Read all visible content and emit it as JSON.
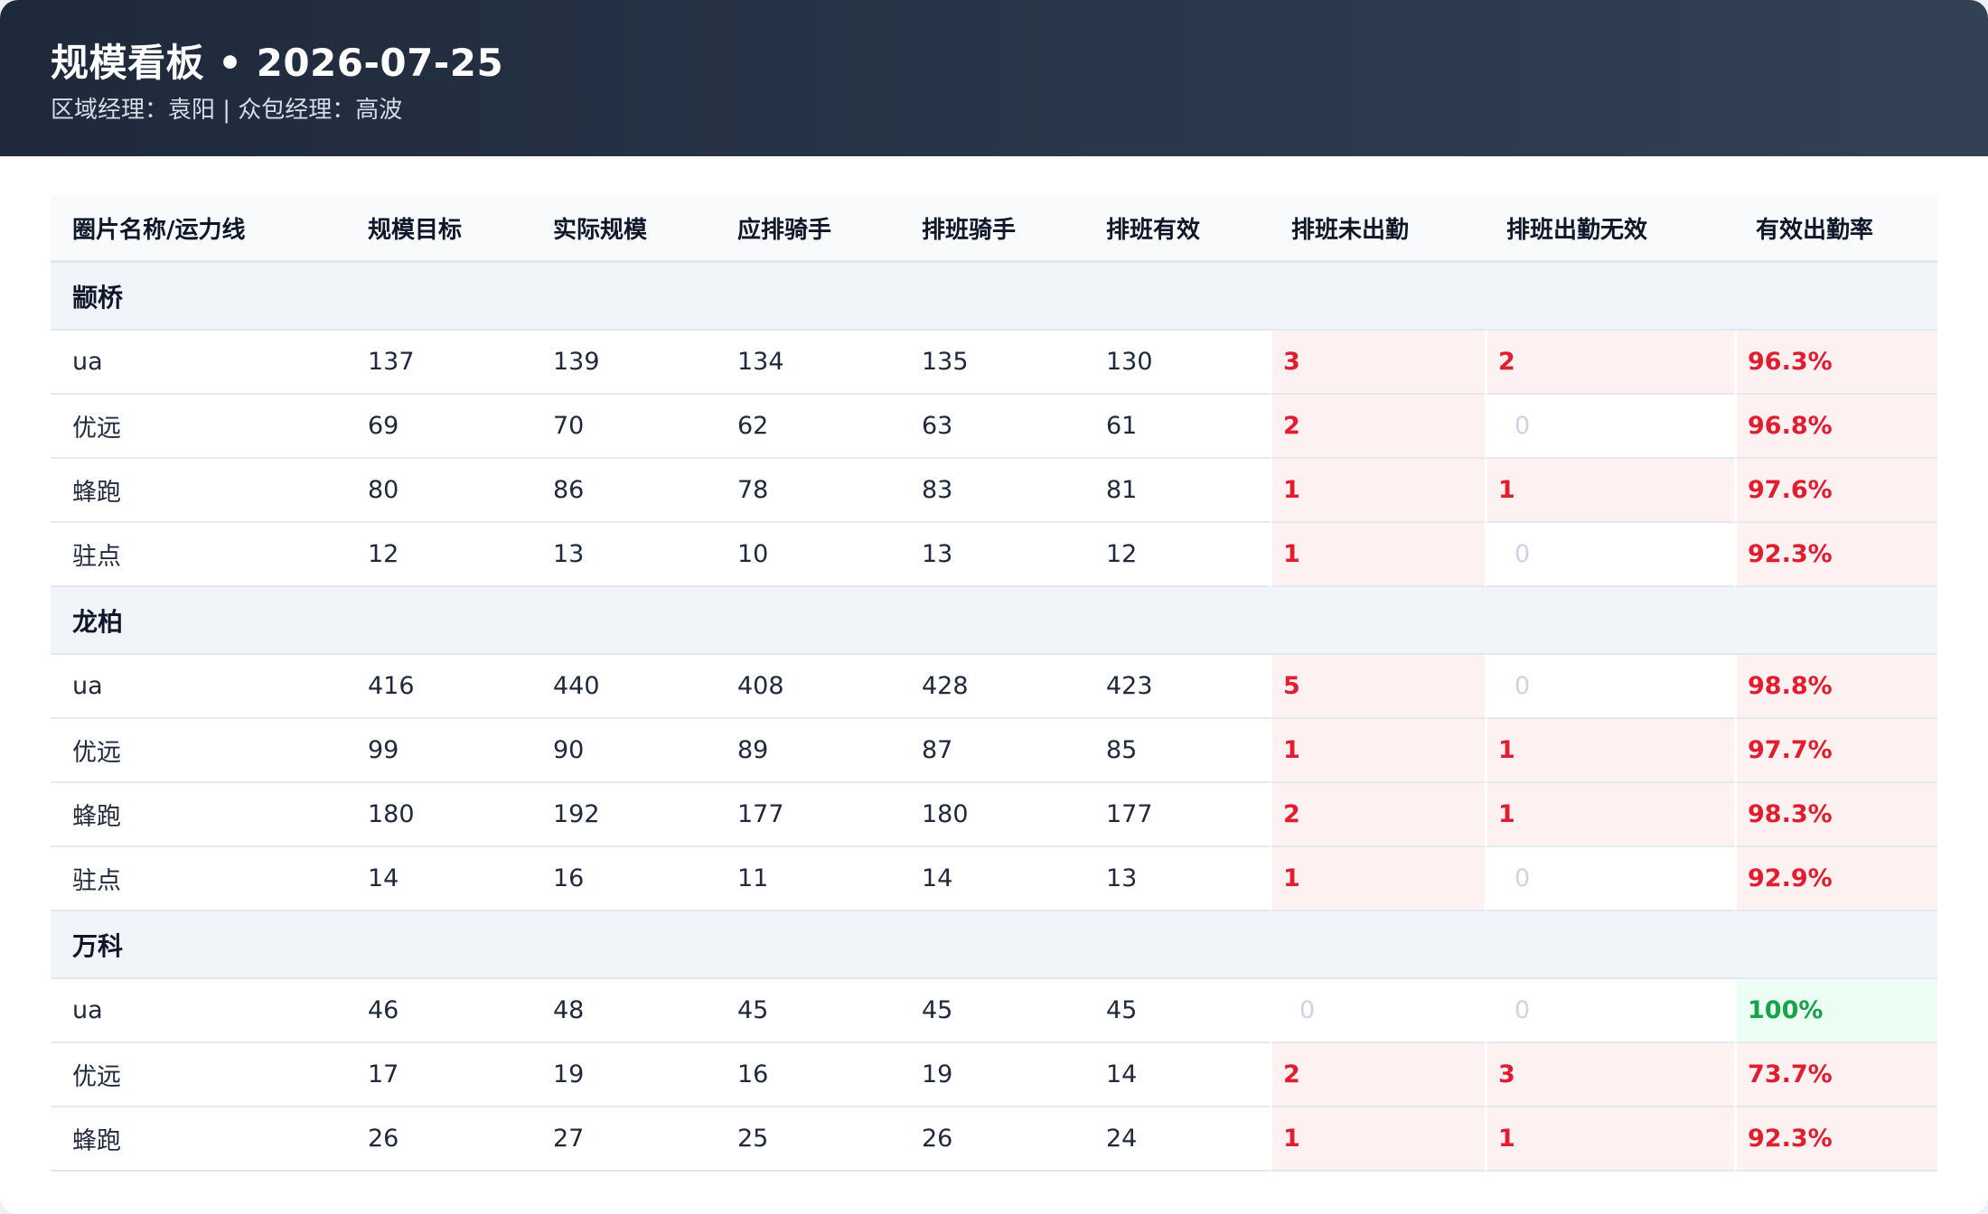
{
  "header": {
    "title": "规模看板 • 2026-07-25",
    "subtitle": "区域经理：袁阳 | 众包经理：高波"
  },
  "table": {
    "columns": [
      "圈片名称/运力线",
      "规模目标",
      "实际规模",
      "应排骑手",
      "排班骑手",
      "排班有效",
      "排班未出勤",
      "排班出勤无效",
      "有效出勤率"
    ],
    "groups": [
      {
        "name": "颛桥",
        "rows": [
          {
            "name": "ua",
            "target": "137",
            "actual": "139",
            "should": "134",
            "scheduled": "135",
            "valid": "130",
            "absent": "3",
            "invalid": "2",
            "rate": "96.3%"
          },
          {
            "name": "优远",
            "target": "69",
            "actual": "70",
            "should": "62",
            "scheduled": "63",
            "valid": "61",
            "absent": "2",
            "invalid": "0",
            "rate": "96.8%"
          },
          {
            "name": "蜂跑",
            "target": "80",
            "actual": "86",
            "should": "78",
            "scheduled": "83",
            "valid": "81",
            "absent": "1",
            "invalid": "1",
            "rate": "97.6%"
          },
          {
            "name": "驻点",
            "target": "12",
            "actual": "13",
            "should": "10",
            "scheduled": "13",
            "valid": "12",
            "absent": "1",
            "invalid": "0",
            "rate": "92.3%"
          }
        ]
      },
      {
        "name": "龙柏",
        "rows": [
          {
            "name": "ua",
            "target": "416",
            "actual": "440",
            "should": "408",
            "scheduled": "428",
            "valid": "423",
            "absent": "5",
            "invalid": "0",
            "rate": "98.8%"
          },
          {
            "name": "优远",
            "target": "99",
            "actual": "90",
            "should": "89",
            "scheduled": "87",
            "valid": "85",
            "absent": "1",
            "invalid": "1",
            "rate": "97.7%"
          },
          {
            "name": "蜂跑",
            "target": "180",
            "actual": "192",
            "should": "177",
            "scheduled": "180",
            "valid": "177",
            "absent": "2",
            "invalid": "1",
            "rate": "98.3%"
          },
          {
            "name": "驻点",
            "target": "14",
            "actual": "16",
            "should": "11",
            "scheduled": "14",
            "valid": "13",
            "absent": "1",
            "invalid": "0",
            "rate": "92.9%"
          }
        ]
      },
      {
        "name": "万科",
        "rows": [
          {
            "name": "ua",
            "target": "46",
            "actual": "48",
            "should": "45",
            "scheduled": "45",
            "valid": "45",
            "absent": "0",
            "invalid": "0",
            "rate": "100%"
          },
          {
            "name": "优远",
            "target": "17",
            "actual": "19",
            "should": "16",
            "scheduled": "19",
            "valid": "14",
            "absent": "2",
            "invalid": "3",
            "rate": "73.7%"
          },
          {
            "name": "蜂跑",
            "target": "26",
            "actual": "27",
            "should": "25",
            "scheduled": "26",
            "valid": "24",
            "absent": "1",
            "invalid": "1",
            "rate": "92.3%"
          }
        ]
      }
    ]
  },
  "colors": {
    "header_dark": "#1e293b",
    "alert_red": "#e11d2f",
    "alert_bg": "#fdf1f2",
    "good_green": "#16a34a",
    "good_bg": "#ecfdf3"
  }
}
